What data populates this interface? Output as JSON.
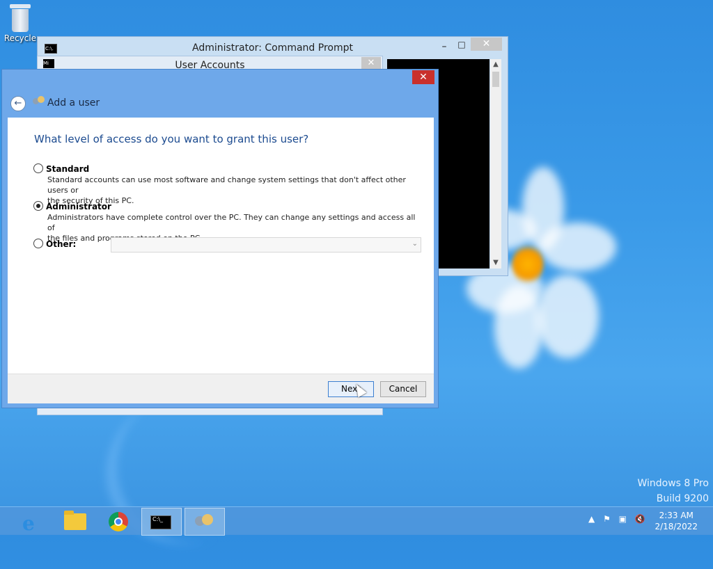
{
  "desktop": {
    "recycle_label": "Recycle",
    "watermark_line1": "Windows 8 Pro",
    "watermark_line2": "Build 9200"
  },
  "cmd_window": {
    "title": "Administrator: Command Prompt",
    "icon_text": "C:\\.",
    "minimize": "–",
    "maximize": "□",
    "close": "✕"
  },
  "user_accounts_window": {
    "title": "User Accounts",
    "icon_text": "Mi",
    "close": "✕"
  },
  "dialog": {
    "close": "✕",
    "back": "←",
    "header_title": "Add a user",
    "question": "What level of access do you want to grant this user?",
    "options": [
      {
        "label": "Standard",
        "selected": false,
        "description_line1": "Standard accounts can use most software and change system settings that don't affect other users or",
        "description_line2": "the security of this PC."
      },
      {
        "label": "Administrator",
        "selected": true,
        "description_line1": "Administrators have complete control over the PC. They can change any settings and access all of",
        "description_line2": "the files and programs stored on the PC."
      },
      {
        "label": "Other:",
        "selected": false,
        "select_value": ""
      }
    ],
    "buttons": {
      "next": "Next",
      "cancel": "Cancel"
    }
  },
  "taskbar": {
    "items": [
      "internet-explorer",
      "file-explorer",
      "chrome",
      "command-prompt",
      "user-accounts"
    ],
    "active": "user-accounts",
    "clock_time": "2:33 AM",
    "clock_date": "2/18/2022",
    "tray_icons": [
      "chevron-up-icon",
      "flag-icon",
      "network-icon",
      "volume-muted-icon"
    ]
  }
}
